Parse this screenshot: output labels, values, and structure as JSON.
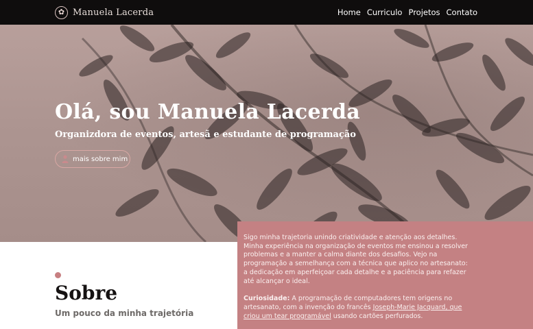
{
  "nav": {
    "brand_name": "Manuela Lacerda",
    "brand_icon": "flower-icon",
    "links": [
      {
        "label": "Home"
      },
      {
        "label": "Curriculo"
      },
      {
        "label": "Projetos"
      },
      {
        "label": "Contato"
      }
    ]
  },
  "hero": {
    "title": "Olá, sou Manuela Lacerda",
    "subtitle": "Organizdora de eventos, artesã e estudante de programação",
    "button_label": "mais sobre mim",
    "button_icon": "person-icon"
  },
  "about": {
    "title": "Sobre",
    "subtitle": "Um pouco da minha trajetória"
  },
  "info": {
    "paragraph1": "Sigo minha trajetoria unindo criatividade e atenção aos detalhes. Minha experiência na organização de eventos me ensinou a resolver problemas e a manter a calma diante dos desafios. Vejo na programação a semelhança com a técnica que aplico no artesanato: a dedicação em aperfeiçoar cada detalhe e a paciência para refazer até alcançar o ideal.",
    "curiosity_label": "Curiosidade:",
    "curiosity_text_before": " A programação de computadores tem origens no artesanato, com a invenção do francês ",
    "curiosity_link": "Joseph-Marie Jacquard, que criou um tear programável",
    "curiosity_text_after": " usando cartões perfurados."
  },
  "colors": {
    "navbar": "#0f0d0d",
    "accent": "#c48183",
    "hero_base": "#ad9591",
    "dark_text": "#151212"
  }
}
